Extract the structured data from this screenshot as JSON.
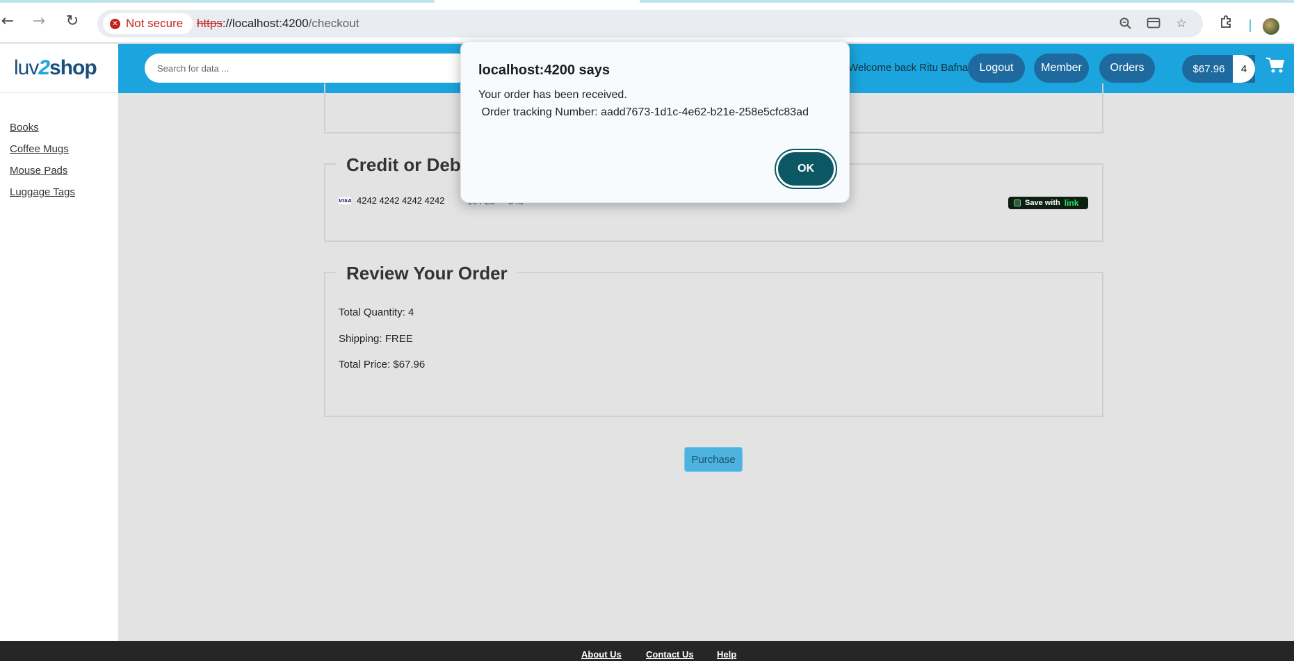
{
  "browser": {
    "security_label": "Not secure",
    "url_scheme": "https",
    "url_host": "://localhost:4200",
    "url_path": "/checkout"
  },
  "header": {
    "logo_luv": "luv",
    "logo_two": "2",
    "logo_shop": "shop",
    "search_placeholder": "Search for data ...",
    "welcome_text": "Welcome back Ritu Bafna",
    "logout_label": "Logout",
    "member_label": "Member",
    "orders_label": "Orders",
    "cart_total": "$67.96",
    "cart_count": "4"
  },
  "sidebar": {
    "items": [
      {
        "label": "Books"
      },
      {
        "label": "Coffee Mugs"
      },
      {
        "label": "Mouse Pads"
      },
      {
        "label": "Luggage Tags"
      }
    ]
  },
  "payment": {
    "legend": "Credit or Deb",
    "card_brand": "VISA",
    "card_number": "4242 4242 4242 4242",
    "card_expiry": "10 / 28",
    "card_cvc": "343",
    "link_save_text": "Save with",
    "link_brand": "link"
  },
  "review": {
    "legend": "Review Your Order",
    "total_quantity": "Total Quantity: 4",
    "shipping": "Shipping: FREE",
    "total_price": "Total Price: $67.96"
  },
  "purchase_label": "Purchase",
  "footer": {
    "about": "About Us",
    "contact": "Contact Us",
    "help": "Help"
  },
  "dialog": {
    "title": "localhost:4200 says",
    "message_line1": "Your order has been received.",
    "message_line2": " Order tracking Number: aadd7673-1d1c-4e62-b21e-258e5cfc83ad",
    "ok_label": "OK"
  },
  "colors": {
    "brand_blue": "#1ba4dd",
    "pill_blue": "#1e6a9e",
    "dialog_ok": "#0b5763",
    "footer": "#262626"
  }
}
